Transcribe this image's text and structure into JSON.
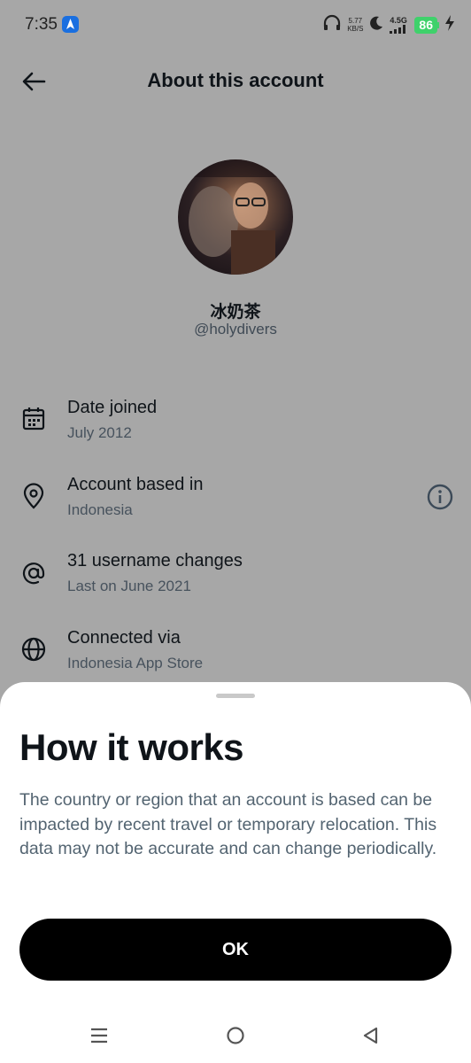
{
  "status_bar": {
    "time": "7:35",
    "net_speed_value": "5.77",
    "net_speed_unit": "KB/S",
    "network_gen": "4.5G",
    "battery": "86"
  },
  "header": {
    "title": "About this account",
    "back_icon": "arrow-left-icon"
  },
  "profile": {
    "display_name": "冰奶茶",
    "handle": "@holydivers"
  },
  "info": [
    {
      "title": "Date joined",
      "subtitle": "July 2012",
      "icon": "calendar-icon"
    },
    {
      "title": "Account based in",
      "subtitle": "Indonesia",
      "icon": "location-pin-icon",
      "action_icon": "info-icon"
    },
    {
      "title": "31 username changes",
      "subtitle": "Last on June 2021",
      "icon": "at-sign-icon"
    },
    {
      "title": "Connected via",
      "subtitle": "Indonesia App Store",
      "icon": "globe-icon"
    }
  ],
  "sheet": {
    "title": "How it works",
    "body": "The country or region that an account is based can be impacted by recent travel or temporary relocation. This data may not be accurate and can change periodically.",
    "ok_label": "OK"
  },
  "nav": {
    "menu_icon": "menu-icon",
    "home_icon": "home-circle-icon",
    "back_icon": "back-triangle-icon"
  },
  "colors": {
    "scrim": "#a7a7a7",
    "text_primary": "#0f1419",
    "text_secondary": "#536471",
    "button_bg": "#000000",
    "battery": "#3fd16b"
  }
}
